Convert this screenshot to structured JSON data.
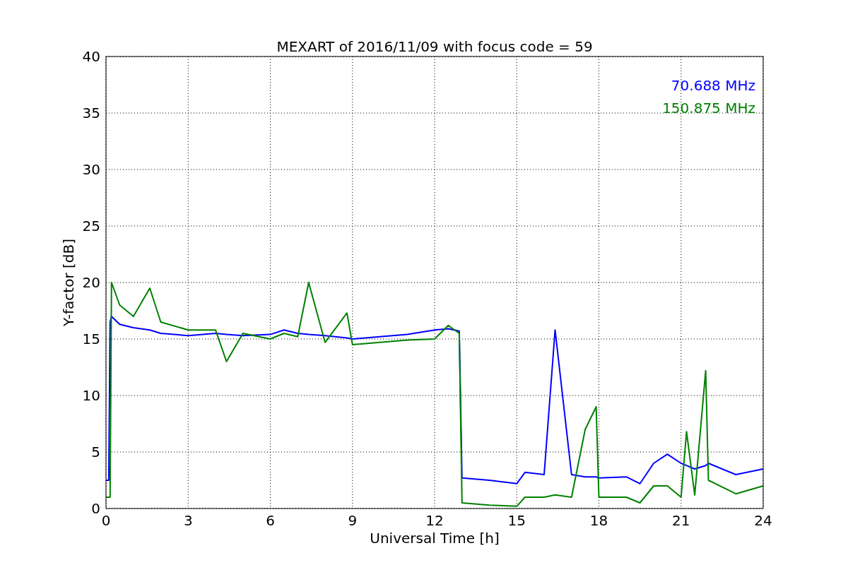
{
  "figure": {
    "chart_data": {
      "type": "line",
      "title": "MEXART of 2016/11/09 with focus code = 59",
      "xlabel": "Universal Time [h]",
      "ylabel": "Y-factor [dB]",
      "x": [
        0,
        0.1,
        0.15,
        0.2,
        0.5,
        1,
        1.6,
        2,
        3,
        4,
        4.4,
        5,
        6,
        6.5,
        7,
        7.4,
        8,
        8.8,
        9,
        10,
        11,
        12,
        12.5,
        12.9,
        13,
        14,
        15,
        15.3,
        16,
        16.4,
        17,
        17.5,
        17.9,
        18,
        19,
        19.5,
        20,
        20.5,
        21,
        21.2,
        21.5,
        21.9,
        22,
        23,
        24
      ],
      "series": [
        {
          "name": "70.688 MHz",
          "color": "#0000ff",
          "values": [
            2.5,
            2.5,
            16.5,
            17,
            16.3,
            16,
            15.8,
            15.5,
            15.3,
            15.5,
            15.4,
            15.3,
            15.4,
            15.8,
            15.5,
            15.4,
            15.3,
            15.1,
            15,
            15.2,
            15.4,
            15.8,
            15.9,
            15.7,
            2.7,
            2.5,
            2.2,
            3.2,
            3,
            15.8,
            3,
            2.8,
            2.8,
            2.7,
            2.8,
            2.2,
            4,
            4.8,
            4,
            3.8,
            3.5,
            3.8,
            4,
            3,
            3.5
          ]
        },
        {
          "name": "150.875 MHz",
          "color": "#008000",
          "values": [
            1,
            1,
            1,
            20,
            18,
            17,
            19.5,
            16.5,
            15.8,
            15.8,
            13,
            15.5,
            15,
            15.5,
            15.2,
            20,
            14.7,
            17.3,
            14.5,
            14.7,
            14.9,
            15,
            16.2,
            15.5,
            0.5,
            0.3,
            0.2,
            1,
            1,
            1.2,
            1,
            7,
            9,
            1,
            1,
            0.5,
            2,
            2,
            1,
            6.8,
            1.2,
            12.2,
            2.5,
            1.3,
            2
          ]
        }
      ],
      "xlim": [
        0,
        24
      ],
      "ylim": [
        0,
        40
      ],
      "xticks": [
        0,
        3,
        6,
        9,
        12,
        15,
        18,
        21,
        24
      ],
      "yticks": [
        0,
        5,
        10,
        15,
        20,
        25,
        30,
        35,
        40
      ],
      "grid": true
    }
  }
}
